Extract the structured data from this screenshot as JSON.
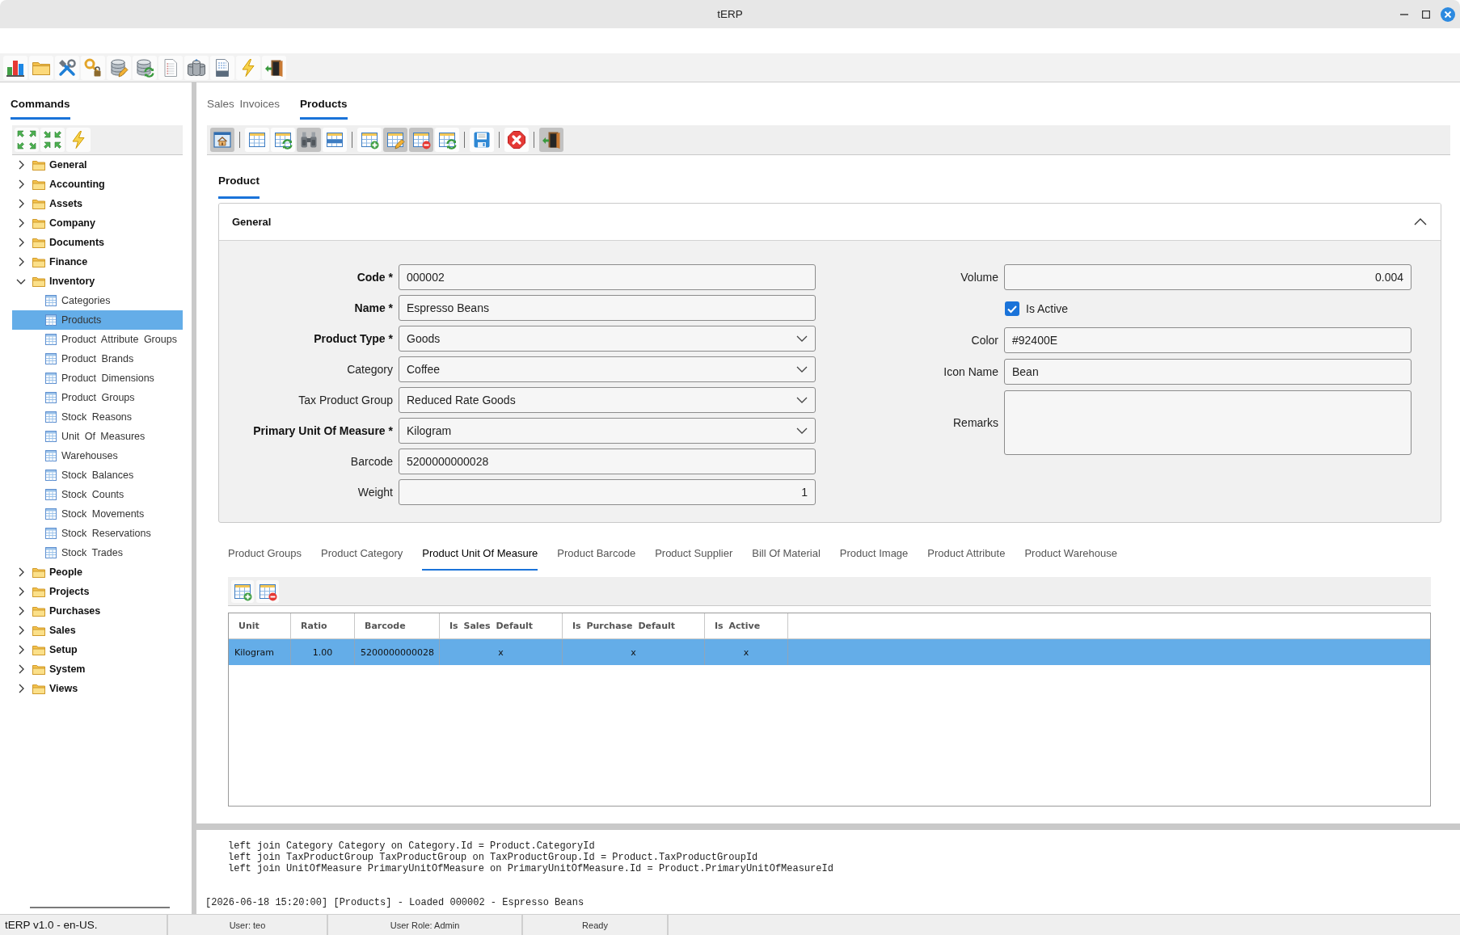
{
  "window": {
    "title": "tERP"
  },
  "sidebar": {
    "tabs": [
      {
        "label": "Commands",
        "selected": true
      }
    ],
    "tree": [
      {
        "kind": "folder",
        "label": "General",
        "expanded": false,
        "selected": false
      },
      {
        "kind": "folder",
        "label": "Accounting",
        "expanded": false,
        "selected": false
      },
      {
        "kind": "folder",
        "label": "Assets",
        "expanded": false,
        "selected": false
      },
      {
        "kind": "folder",
        "label": "Company",
        "expanded": false,
        "selected": false
      },
      {
        "kind": "folder",
        "label": "Documents",
        "expanded": false,
        "selected": false
      },
      {
        "kind": "folder",
        "label": "Finance",
        "expanded": false,
        "selected": false
      },
      {
        "kind": "folder",
        "label": "Inventory",
        "expanded": true,
        "selected": false,
        "children": [
          {
            "kind": "view",
            "label": "Categories",
            "selected": false
          },
          {
            "kind": "view",
            "label": "Products",
            "selected": true
          },
          {
            "kind": "view",
            "label": "Product Attribute Groups",
            "selected": false
          },
          {
            "kind": "view",
            "label": "Product Brands",
            "selected": false
          },
          {
            "kind": "view",
            "label": "Product Dimensions",
            "selected": false
          },
          {
            "kind": "view",
            "label": "Product Groups",
            "selected": false
          },
          {
            "kind": "view",
            "label": "Stock Reasons",
            "selected": false
          },
          {
            "kind": "view",
            "label": "Unit Of Measures",
            "selected": false
          },
          {
            "kind": "view",
            "label": "Warehouses",
            "selected": false
          },
          {
            "kind": "view",
            "label": "Stock Balances",
            "selected": false
          },
          {
            "kind": "view",
            "label": "Stock Counts",
            "selected": false
          },
          {
            "kind": "view",
            "label": "Stock Movements",
            "selected": false
          },
          {
            "kind": "view",
            "label": "Stock Reservations",
            "selected": false
          },
          {
            "kind": "view",
            "label": "Stock Trades",
            "selected": false
          }
        ]
      },
      {
        "kind": "folder",
        "label": "People",
        "expanded": false,
        "selected": false
      },
      {
        "kind": "folder",
        "label": "Projects",
        "expanded": false,
        "selected": false
      },
      {
        "kind": "folder",
        "label": "Purchases",
        "expanded": false,
        "selected": false
      },
      {
        "kind": "folder",
        "label": "Sales",
        "expanded": false,
        "selected": false
      },
      {
        "kind": "folder",
        "label": "Setup",
        "expanded": false,
        "selected": false
      },
      {
        "kind": "folder",
        "label": "System",
        "expanded": false,
        "selected": false
      },
      {
        "kind": "folder",
        "label": "Views",
        "expanded": false,
        "selected": false
      }
    ]
  },
  "main_tabs": [
    {
      "label": "Sales Invoices",
      "selected": false
    },
    {
      "label": "Products",
      "selected": true
    }
  ],
  "record_toolbar": {
    "buttons": [
      {
        "pressed": true
      },
      {
        "pressed": false
      },
      {
        "pressed": false
      },
      {
        "pressed": true
      },
      {
        "pressed": false
      },
      {
        "pressed": false
      },
      {
        "pressed": true
      },
      {
        "pressed": true
      },
      {
        "pressed": false
      },
      {
        "pressed": false
      },
      {
        "pressed": false
      },
      {
        "pressed": true
      }
    ]
  },
  "form": {
    "tabs": [
      {
        "label": "Product",
        "selected": true
      }
    ],
    "section": {
      "title": "General",
      "expanded": true
    },
    "left_fields": [
      {
        "kind": "text",
        "label": "Code *",
        "required": true,
        "value": "000002"
      },
      {
        "kind": "text",
        "label": "Name *",
        "required": true,
        "value": "Espresso Beans"
      },
      {
        "kind": "select",
        "label": "Product Type *",
        "required": true,
        "value": "Goods"
      },
      {
        "kind": "select",
        "label": "Category",
        "required": false,
        "value": "Coffee"
      },
      {
        "kind": "select",
        "label": "Tax Product Group",
        "required": false,
        "value": "Reduced Rate Goods"
      },
      {
        "kind": "select",
        "label": "Primary Unit Of Measure *",
        "required": true,
        "value": "Kilogram"
      },
      {
        "kind": "text",
        "label": "Barcode",
        "required": false,
        "value": "5200000000028"
      },
      {
        "kind": "number",
        "label": "Weight",
        "required": false,
        "value": "1"
      }
    ],
    "right_fields": [
      {
        "kind": "number",
        "label": "Volume",
        "required": false,
        "value": "0.004"
      },
      {
        "kind": "checkbox",
        "label": "Is Active",
        "checked": true
      },
      {
        "kind": "text",
        "label": "Color",
        "required": false,
        "value": "#92400E"
      },
      {
        "kind": "text",
        "label": "Icon Name",
        "required": false,
        "value": "Bean"
      },
      {
        "kind": "textarea",
        "label": "Remarks",
        "required": false
      }
    ]
  },
  "detail_tabs": [
    {
      "label": "Product Groups",
      "selected": false
    },
    {
      "label": "Product Category",
      "selected": false
    },
    {
      "label": "Product Unit Of Measure",
      "selected": true
    },
    {
      "label": "Product Barcode",
      "selected": false
    },
    {
      "label": "Product Supplier",
      "selected": false
    },
    {
      "label": "Bill Of Material",
      "selected": false
    },
    {
      "label": "Product Image",
      "selected": false
    },
    {
      "label": "Product Attribute",
      "selected": false
    },
    {
      "label": "Product Warehouse",
      "selected": false
    }
  ],
  "grid": {
    "columns": [
      "Unit",
      "Ratio",
      "Barcode",
      "Is Sales Default",
      "Is Purchase Default",
      "Is Active"
    ],
    "rows": [
      {
        "selected": true,
        "cells": [
          "Kilogram",
          "1.00",
          "5200000000028",
          "x",
          "x",
          "x"
        ]
      }
    ]
  },
  "log": {
    "query_lines": [
      "left join Category Category on Category.Id = Product.CategoryId",
      "left join TaxProductGroup TaxProductGroup on TaxProductGroup.Id = Product.TaxProductGroupId",
      "left join UnitOfMeasure PrimaryUnitOfMeasure on PrimaryUnitOfMeasure.Id = Product.PrimaryUnitOfMeasureId"
    ],
    "messages": [
      "[2026-06-18 15:20:00] [Products] - Loaded 000002 - Espresso Beans"
    ]
  },
  "status_bar": {
    "sections": [
      "tERP v1.0 - en-US.",
      "User: teo",
      "User Role: Admin",
      "Ready"
    ]
  }
}
